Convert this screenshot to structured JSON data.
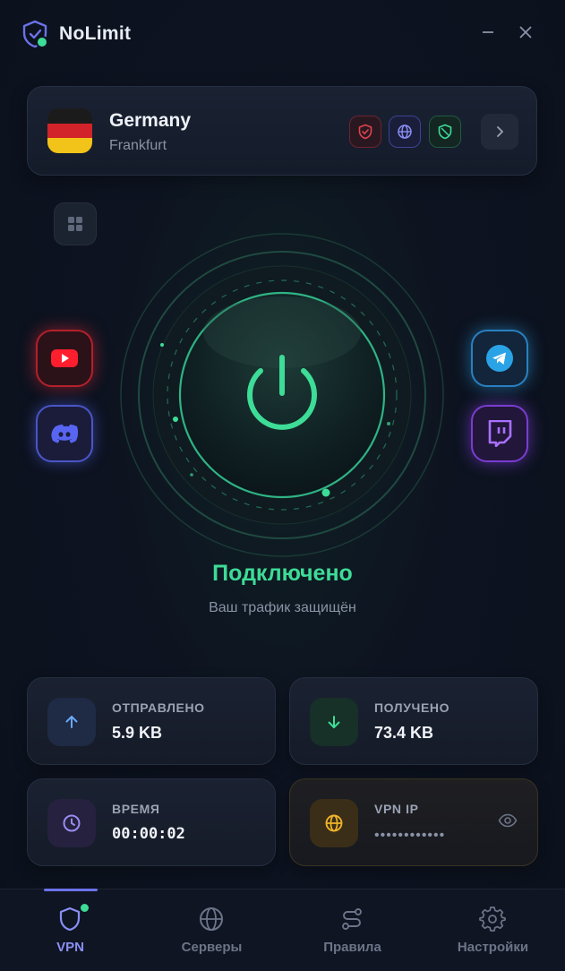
{
  "app": {
    "title": "NoLimit"
  },
  "window": {
    "minimize_icon": "minimize-icon",
    "close_icon": "close-icon"
  },
  "location": {
    "country": "Germany",
    "city": "Frankfurt",
    "flag": "germany-flag",
    "badges": [
      "shield-check-icon",
      "globe-icon",
      "shield-slash-icon"
    ]
  },
  "quick_apps": [
    "youtube",
    "discord",
    "telegram",
    "twitch"
  ],
  "status": {
    "title": "Подключено",
    "subtitle": "Ваш трафик защищён"
  },
  "stats": {
    "sent": {
      "label": "ОТПРАВЛЕНО",
      "value": "5.9 KB"
    },
    "received": {
      "label": "ПОЛУЧЕНО",
      "value": "73.4 KB"
    },
    "time": {
      "label": "ВРЕМЯ",
      "value": "00:00:02"
    },
    "ip": {
      "label": "VPN IP",
      "value": "••••••••••••"
    }
  },
  "nav": {
    "items": [
      {
        "label": "VPN",
        "icon": "shield-icon",
        "active": true
      },
      {
        "label": "Серверы",
        "icon": "globe-icon",
        "active": false
      },
      {
        "label": "Правила",
        "icon": "routes-icon",
        "active": false
      },
      {
        "label": "Настройки",
        "icon": "gear-icon",
        "active": false
      }
    ]
  },
  "colors": {
    "accent_green": "#3ddc97",
    "accent_purple": "#8a8ff5",
    "background": "#0d1320"
  }
}
